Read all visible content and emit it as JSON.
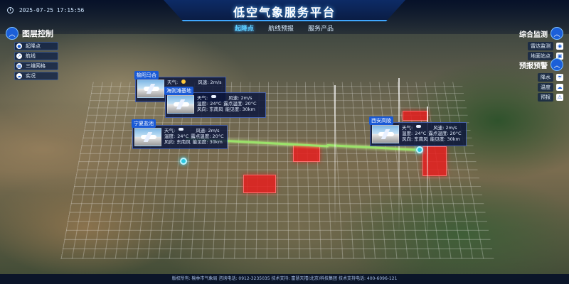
{
  "header": {
    "datetime": "2025-07-25 17:15:56",
    "title": "低空气象服务平台",
    "tabs": [
      {
        "label": "起降点",
        "active": true
      },
      {
        "label": "航线预报",
        "active": false
      },
      {
        "label": "服务产品",
        "active": false
      }
    ]
  },
  "layer_panel": {
    "title": "图层控制",
    "items": [
      {
        "label": "起降点",
        "icon": "pin-icon"
      },
      {
        "label": "航线",
        "icon": "route-icon"
      },
      {
        "label": "三维网格",
        "icon": "grid-icon"
      },
      {
        "label": "实况",
        "icon": "cloud-icon"
      }
    ]
  },
  "monitor_panel": {
    "title": "综合监测",
    "items": [
      {
        "label": "雷达监测",
        "icon": "radar-icon"
      },
      {
        "label": "地面站点",
        "icon": "station-icon"
      }
    ]
  },
  "warning_panel": {
    "title": "预报预警",
    "items": [
      {
        "label": "降水",
        "icon": "rain-icon"
      },
      {
        "label": "温度",
        "icon": "temperature-icon"
      },
      {
        "label": "预报",
        "icon": "forecast-icon"
      }
    ]
  },
  "cards": [
    {
      "name": "榆阳马合",
      "weather_label": "天气:",
      "wind_speed": "风速: 2m/s",
      "temp": "温度:",
      "temp_value": "24°C",
      "dew": "露点温度: 20°C",
      "wind_dir": "风向: 东南风",
      "visibility": "能见度: 30km"
    },
    {
      "name": "海则滩基地",
      "weather_label": "天气:",
      "wind_speed": "风速: 2m/s",
      "temp": "温度:",
      "temp_value": "24°C",
      "dew": "露点温度: 20°C",
      "wind_dir": "风向: 东南风",
      "visibility": "能见度: 30km"
    },
    {
      "name": "宁夏盐池",
      "weather_label": "天气:",
      "wind_speed": "风速: 2m/s",
      "temp": "温度:",
      "temp_value": "24°C",
      "dew": "露点温度: 20°C",
      "wind_dir": "风向: 东南风",
      "visibility": "能见度: 30km"
    },
    {
      "name": "西安高陵",
      "weather_label": "天气:",
      "wind_speed": "风速: 2m/s",
      "temp": "温度:",
      "temp_value": "24°C",
      "dew": "露点温度: 20°C",
      "wind_dir": "风向: 东南风",
      "visibility": "能见度: 30km"
    }
  ],
  "footer": {
    "text": "版权所有: 榆林市气象局   咨询电话: 0912-3235035   技术支持: 富慧天禧(北京)科技集团   技术支持电话: 400-6096-121"
  },
  "colors": {
    "accent": "#1b5fd8",
    "route": "#9be36a",
    "block": "#e61e1e"
  }
}
